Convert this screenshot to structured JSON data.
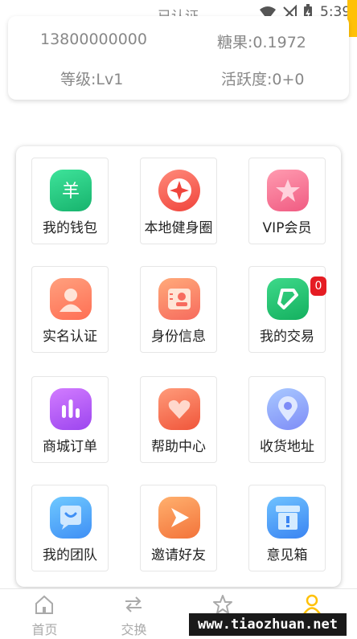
{
  "status_bar": {
    "verified_label": "已认证",
    "time": "5:39",
    "accent_color": "#ffc107"
  },
  "user_card": {
    "phone": "13800000000",
    "candy": "糖果:0.1972",
    "level": "等级:Lv1",
    "activity": "活跃度:0+0"
  },
  "menu": {
    "items": [
      {
        "label": "我的钱包",
        "icon": "wallet-icon"
      },
      {
        "label": "本地健身圈",
        "icon": "fitness-circle-icon"
      },
      {
        "label": "VIP会员",
        "icon": "vip-star-icon"
      },
      {
        "label": "实名认证",
        "icon": "user-verify-icon"
      },
      {
        "label": "身份信息",
        "icon": "id-card-icon"
      },
      {
        "label": "我的交易",
        "icon": "trade-icon"
      },
      {
        "label": "商城订单",
        "icon": "orders-chart-icon"
      },
      {
        "label": "帮助中心",
        "icon": "help-heart-icon"
      },
      {
        "label": "收货地址",
        "icon": "location-pin-icon"
      },
      {
        "label": "我的团队",
        "icon": "team-chat-icon"
      },
      {
        "label": "邀请好友",
        "icon": "invite-play-icon"
      },
      {
        "label": "意见箱",
        "icon": "feedback-box-icon"
      }
    ],
    "trade_badge": "0"
  },
  "tab_bar": {
    "tabs": [
      {
        "label": "首页",
        "icon": "home-icon"
      },
      {
        "label": "交换",
        "icon": "exchange-icon"
      },
      {
        "label": "",
        "icon": "star-icon"
      },
      {
        "label": "",
        "icon": "profile-icon"
      }
    ]
  },
  "watermark": "www.tiaozhuan.net"
}
